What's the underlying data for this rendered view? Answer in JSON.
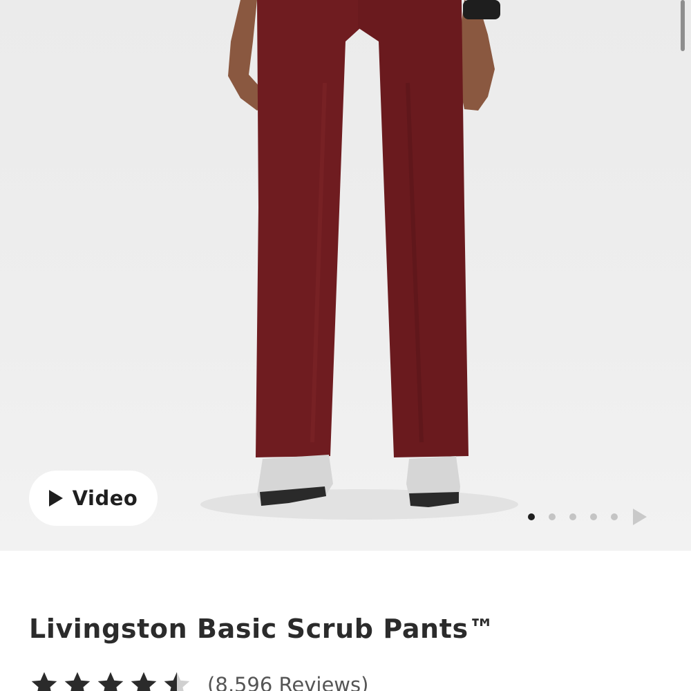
{
  "colors": {
    "pants": "#6f1c20",
    "background": "#ececec",
    "shoe": "#d6d6d6",
    "text": "#2b2b2b"
  },
  "hero": {
    "video_label": "Video",
    "play_icon": "play-icon",
    "carousel": {
      "total_dots": 5,
      "active_index": 0,
      "next_icon": "next-arrow-icon"
    }
  },
  "product": {
    "title": "Livingston Basic Scrub Pants™",
    "rating": 4.5,
    "reviews_text": "(8,596 Reviews)"
  }
}
